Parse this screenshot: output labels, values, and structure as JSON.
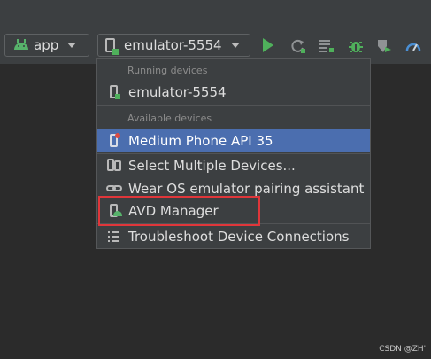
{
  "toolbar": {
    "module_selector": "app",
    "device_selector": "emulator-5554"
  },
  "device_menu": {
    "running_header": "Running devices",
    "running_devices": [
      "emulator-5554"
    ],
    "available_header": "Available devices",
    "available_devices": [
      "Medium Phone API 35"
    ],
    "actions": [
      "Select Multiple Devices...",
      "Wear OS emulator pairing assistant",
      "AVD Manager"
    ],
    "footer_action": "Troubleshoot Device Connections"
  },
  "watermark": "CSDN @ZH'.",
  "colors": {
    "background": "#2b2b2b",
    "toolbar": "#3c3f41",
    "selection": "#4b6eaf",
    "run_green": "#4fb05b",
    "highlight_red": "#e0363a"
  },
  "icons": {
    "module": "android-icon",
    "device": "phone-icon",
    "run": "play-icon",
    "apply_changes": "apply-changes-icon",
    "apply_code": "apply-code-icon",
    "debug": "bug-icon",
    "attach": "attach-debugger-icon",
    "profile": "profiler-icon"
  }
}
